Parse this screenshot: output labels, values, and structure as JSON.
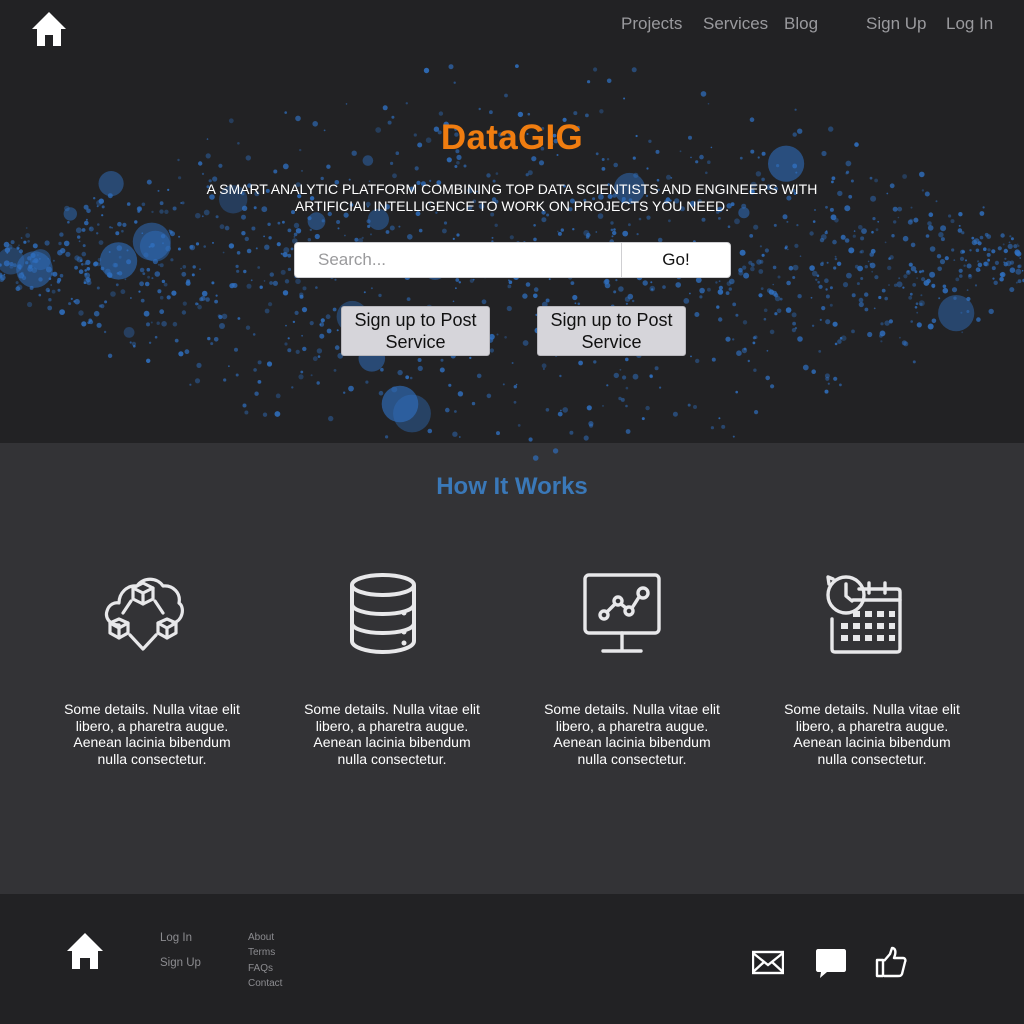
{
  "nav": {
    "home_icon": "home-icon",
    "links": [
      "Projects",
      "Services",
      "Blog"
    ],
    "auth": [
      "Sign Up",
      "Log In"
    ]
  },
  "hero": {
    "brand": "DataGIG",
    "tagline": "A smart analytic platform combining top data scientists and engineers with artificial intelligence to work on projects you need.",
    "search_placeholder": "Search...",
    "search_button": "Go!",
    "cta_left": "Sign up to Post Service",
    "cta_right": "Sign up to Post Service"
  },
  "how": {
    "title": "How It Works",
    "features": [
      {
        "icon": "cloud-network-icon",
        "text": "Some details. Nulla vitae elit libero, a pharetra augue. Aenean lacinia bibendum nulla consectetur."
      },
      {
        "icon": "database-icon",
        "text": "Some details. Nulla vitae elit libero, a pharetra augue. Aenean lacinia bibendum nulla consectetur."
      },
      {
        "icon": "analytics-monitor-icon",
        "text": "Some details. Nulla vitae elit libero, a pharetra augue. Aenean lacinia bibendum nulla consectetur."
      },
      {
        "icon": "calendar-clock-icon",
        "text": "Some details. Nulla vitae elit libero, a pharetra augue. Aenean lacinia bibendum nulla consectetur."
      }
    ]
  },
  "footer": {
    "home_icon": "home-icon",
    "col1": [
      "Log In",
      "Sign Up"
    ],
    "col2": [
      "About",
      "Terms",
      "FAQs",
      "Contact"
    ],
    "social": [
      "mail-icon",
      "chat-icon",
      "thumbs-up-icon"
    ]
  },
  "colors": {
    "background": "#222224",
    "section": "#333336",
    "brand": "#f07d10",
    "accent": "#3a78b8",
    "dots": "#2f6fbf"
  }
}
